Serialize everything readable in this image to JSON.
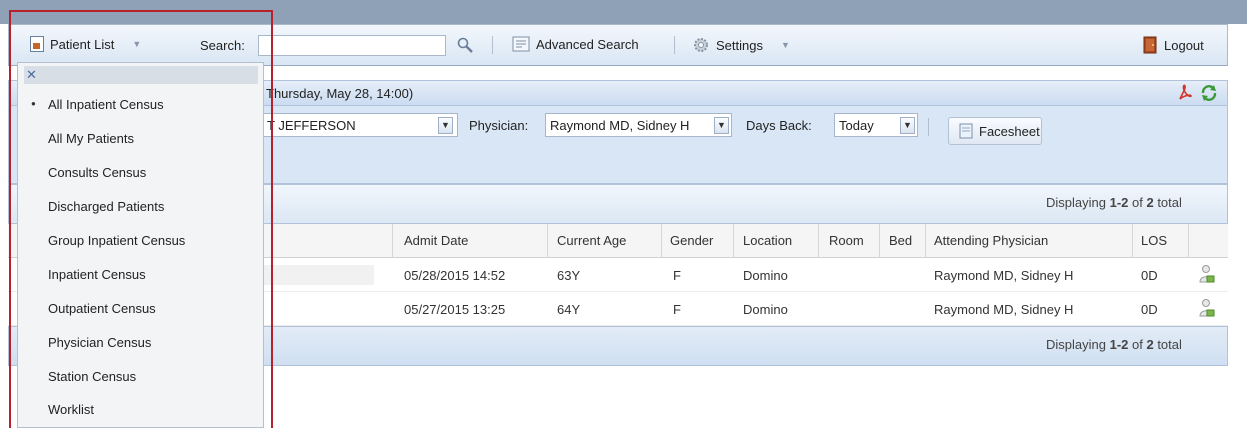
{
  "toolbar": {
    "patient_list_label": "Patient List",
    "search_label": "Search:",
    "search_value": "",
    "search_placeholder": "",
    "advanced_search_label": "Advanced Search",
    "settings_label": "Settings",
    "logout_label": "Logout"
  },
  "panel": {
    "title_partial": "Thursday, May 28, 14:00)",
    "facility_value": "T JEFFERSON",
    "physician_label": "Physician:",
    "physician_value": "Raymond MD, Sidney H",
    "days_back_label": "Days Back:",
    "days_back_value": "Today",
    "facesheet_label": "Facesheet"
  },
  "paging": {
    "prefix": "Displaying ",
    "range": "1-2",
    "of": " of ",
    "total": "2",
    "suffix": " total"
  },
  "table": {
    "columns": [
      "Admit Date",
      "Current Age",
      "Gender",
      "Location",
      "Room",
      "Bed",
      "Attending Physician",
      "LOS"
    ],
    "rows": [
      {
        "admit_date": "05/28/2015 14:52",
        "age": "63Y",
        "gender": "F",
        "location": "Domino",
        "room": "",
        "bed": "",
        "attending": "Raymond MD, Sidney H",
        "los": "0D"
      },
      {
        "admit_date": "05/27/2015 13:25",
        "age": "64Y",
        "gender": "F",
        "location": "Domino",
        "room": "",
        "bed": "",
        "attending": "Raymond MD, Sidney H",
        "los": "0D"
      }
    ]
  },
  "dropdown": {
    "close_glyph": "✕",
    "selected_marker": "●",
    "items": [
      "All Inpatient Census",
      "All My Patients",
      "Consults Census",
      "Discharged Patients",
      "Group Inpatient Census",
      "Inpatient Census",
      "Outpatient Census",
      "Physician Census",
      "Station Census",
      "Worklist"
    ]
  },
  "icons": {
    "patient_list": "document-icon",
    "search": "magnifier-icon",
    "advanced_search": "advanced-search-icon",
    "settings": "gear-icon",
    "logout": "logout-door-icon",
    "pdf": "pdf-icon",
    "refresh": "refresh-icon",
    "facesheet": "page-icon",
    "row_action": "person-lock-icon"
  },
  "colors": {
    "highlight_border": "#b8202b",
    "toolbar_bg": "#dbe7f5",
    "panel_bg": "#d9e6f5"
  }
}
